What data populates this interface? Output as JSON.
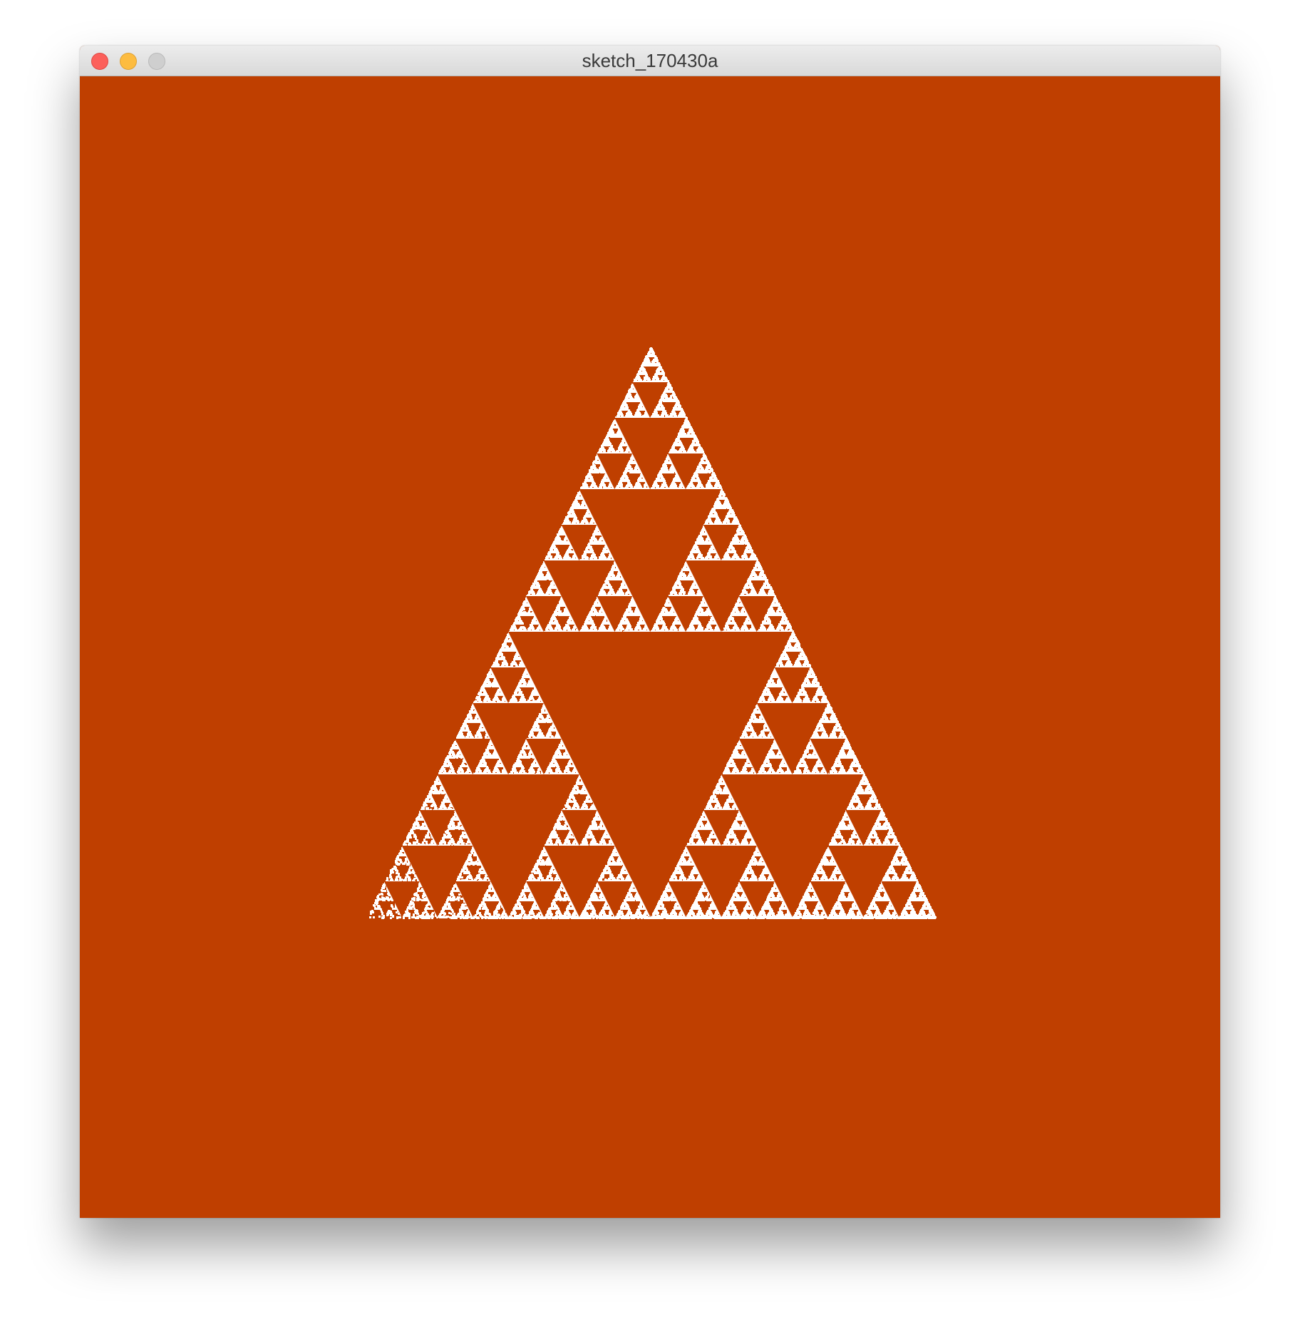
{
  "window": {
    "title": "sketch_170430a"
  },
  "canvas": {
    "background_color": "#bf3f00",
    "fractal_color": "#ffffff",
    "content": "sierpinski-triangle-chaos-game"
  }
}
